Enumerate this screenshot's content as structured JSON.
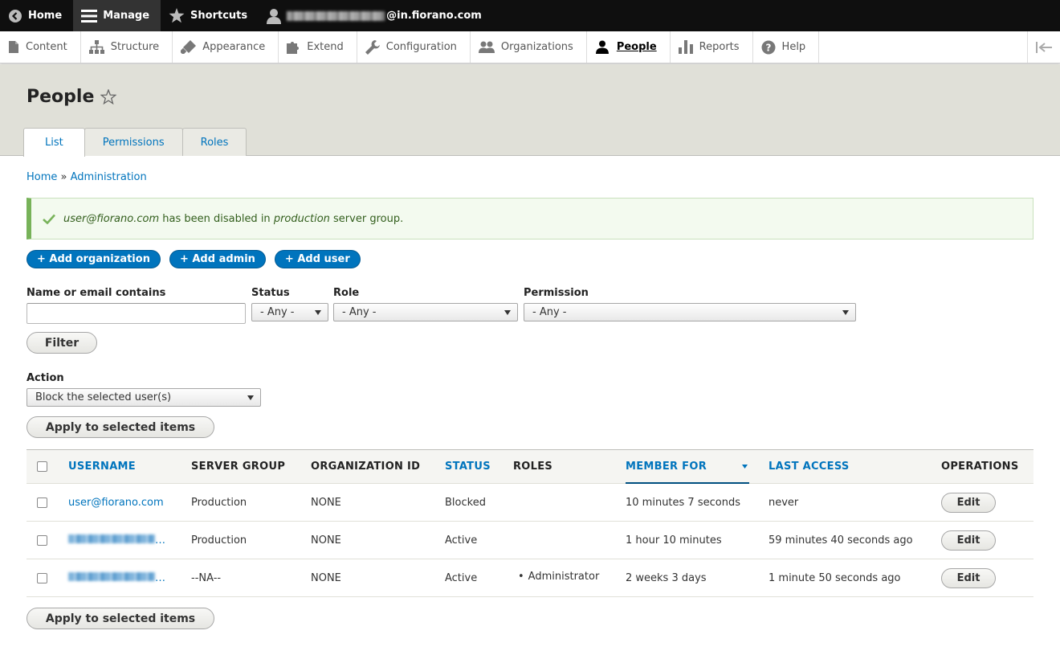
{
  "toolbar": {
    "home": "Home",
    "manage": "Manage",
    "shortcuts": "Shortcuts",
    "user_suffix": "@in.fiorano.com"
  },
  "tray": {
    "items": [
      "Content",
      "Structure",
      "Appearance",
      "Extend",
      "Configuration",
      "Organizations",
      "People",
      "Reports",
      "Help"
    ],
    "active": "People"
  },
  "page": {
    "title": "People",
    "tabs": [
      "List",
      "Permissions",
      "Roles"
    ],
    "active_tab": "List"
  },
  "breadcrumb": {
    "home": "Home",
    "sep": " » ",
    "admin": "Administration"
  },
  "message": {
    "email": "user@fiorano.com",
    "text1": " has been disabled in ",
    "group": "production",
    "text2": " server group."
  },
  "actions": [
    "+ Add organization",
    "+ Add admin",
    "+ Add user"
  ],
  "filters": {
    "name_label": "Name or email contains",
    "name_value": "",
    "status_label": "Status",
    "status_value": "- Any -",
    "role_label": "Role",
    "role_value": "- Any -",
    "permission_label": "Permission",
    "permission_value": "- Any -",
    "filter_button": "Filter"
  },
  "bulk": {
    "action_label": "Action",
    "action_value": "Block the selected user(s)",
    "apply_button": "Apply to selected items"
  },
  "table": {
    "headers": {
      "username": "Username",
      "server_group": "Server group",
      "organization_id": "Organization ID",
      "status": "Status",
      "roles": "Roles",
      "member_for": "Member for",
      "last_access": "Last access",
      "operations": "Operations"
    },
    "rows": [
      {
        "username": "user@fiorano.com",
        "server_group": "Production",
        "organization_id": "NONE",
        "status": "Blocked",
        "roles": "",
        "member_for": "10 minutes 7 seconds",
        "last_access": "never",
        "op": "Edit"
      },
      {
        "username": "…",
        "server_group": "Production",
        "organization_id": "NONE",
        "status": "Active",
        "roles": "",
        "member_for": "1 hour 10 minutes",
        "last_access": "59 minutes 40 seconds ago",
        "op": "Edit"
      },
      {
        "username": "…",
        "server_group": "--NA--",
        "organization_id": "NONE",
        "status": "Active",
        "roles": "Administrator",
        "member_for": "2 weeks 3 days",
        "last_access": "1 minute 50 seconds ago",
        "op": "Edit"
      }
    ]
  },
  "colors": {
    "link": "#0074bd",
    "toolbar_bg": "#0f0f0f",
    "header_bg": "#e0e0d8",
    "message_border": "#77b259"
  }
}
